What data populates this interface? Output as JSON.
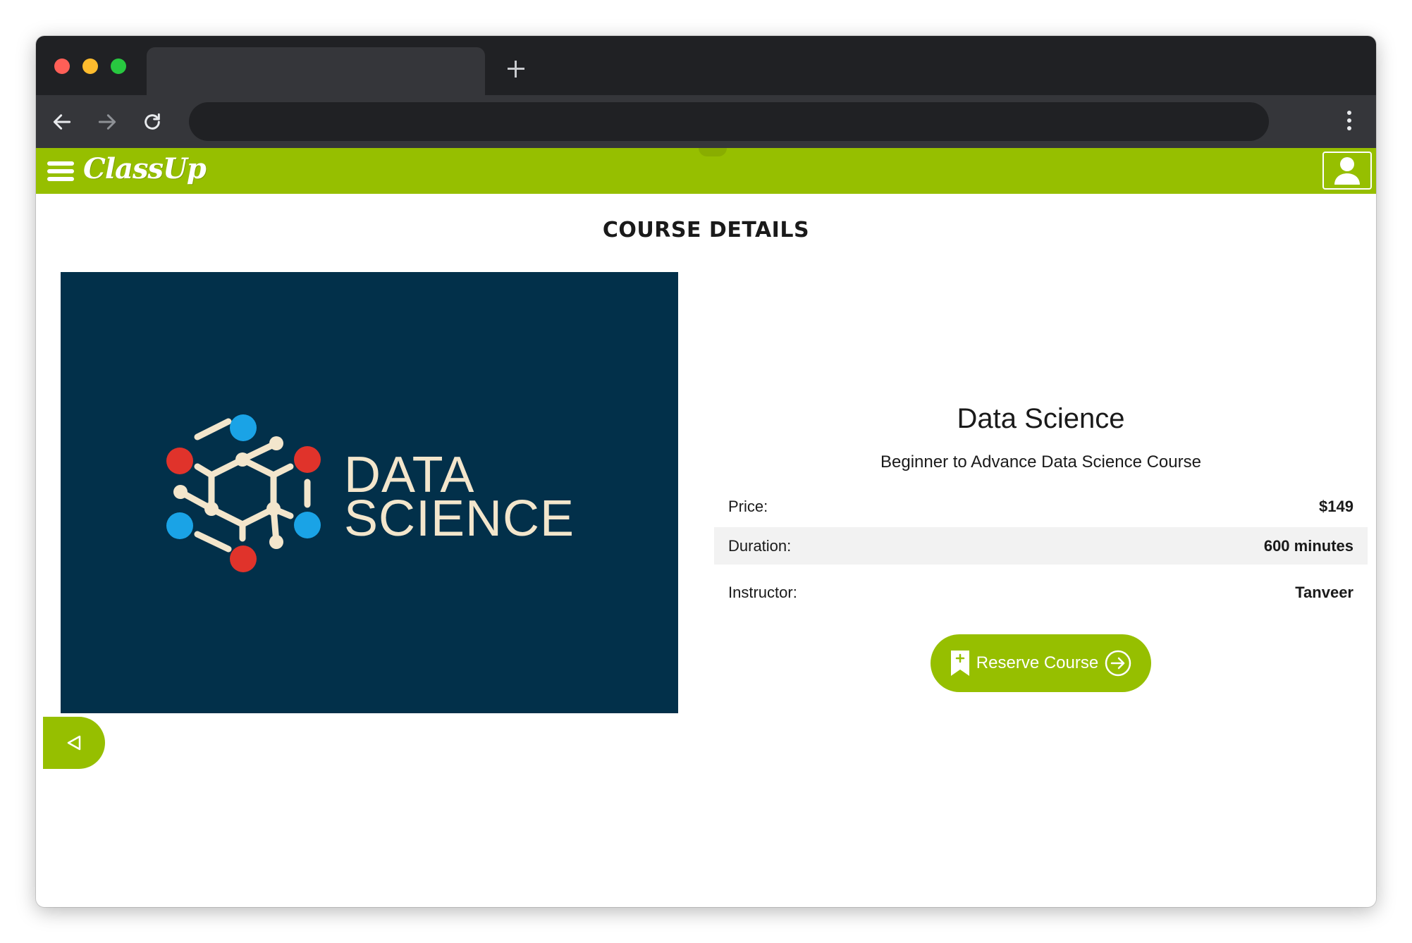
{
  "colors": {
    "brand_green": "#96bf00",
    "image_background": "#02304a",
    "image_text": "#f3e6cc",
    "molecule_red": "#e0332b",
    "molecule_blue": "#1aa3e6"
  },
  "browser": {
    "icons": [
      "back-arrow-icon",
      "forward-arrow-icon",
      "reload-icon",
      "new-tab-icon",
      "kebab-menu-icon"
    ]
  },
  "header": {
    "logo": "ClassUp",
    "icons": [
      "hamburger-menu-icon",
      "user-profile-icon"
    ]
  },
  "page": {
    "title": "COURSE DETAILS"
  },
  "course": {
    "image_line1": "DATA",
    "image_line2": "SCIENCE",
    "name": "Data Science",
    "subtitle": "Beginner to Advance Data Science Course",
    "details": [
      {
        "label": "Price:",
        "value": "$149"
      },
      {
        "label": "Duration:",
        "value": "600 minutes"
      },
      {
        "label": "Instructor:",
        "value": "Tanveer"
      }
    ],
    "reserve_label": "Reserve Course",
    "reserve_icons": [
      "bookmark-plus-icon",
      "arrow-circle-right-icon"
    ]
  },
  "back": {
    "icon": "triangle-left-icon"
  }
}
